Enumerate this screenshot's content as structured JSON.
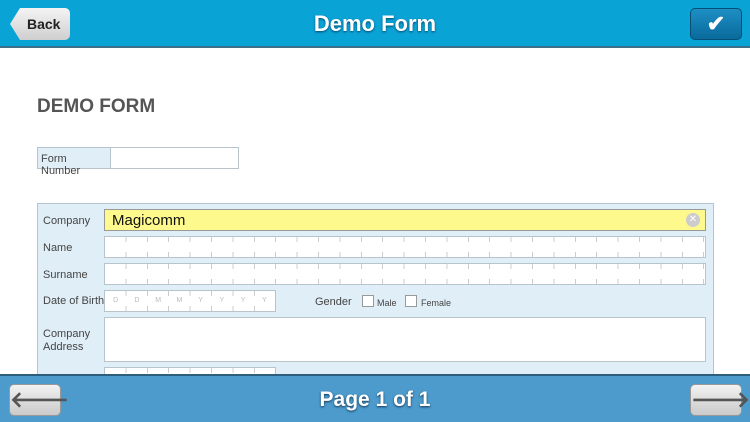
{
  "header": {
    "back_label": "Back",
    "title": "Demo Form",
    "confirm_icon": "checkmark-icon"
  },
  "form": {
    "heading": "DEMO FORM",
    "form_number_label": "Form Number",
    "form_number_value": "",
    "fields": {
      "company_label": "Company",
      "company_value": "Magicomm",
      "name_label": "Name",
      "surname_label": "Surname",
      "dob_label": "Date of Birth",
      "dob_placeholders": [
        "D",
        "D",
        "M",
        "M",
        "Y",
        "Y",
        "Y",
        "Y"
      ],
      "gender_label": "Gender",
      "male_label": "Male",
      "female_label": "Female",
      "address_label_1": "Company",
      "address_label_2": "Address"
    }
  },
  "footer": {
    "page_label": "Page 1 of 1",
    "prev_icon": "arrow-left-icon",
    "next_icon": "arrow-right-icon"
  }
}
